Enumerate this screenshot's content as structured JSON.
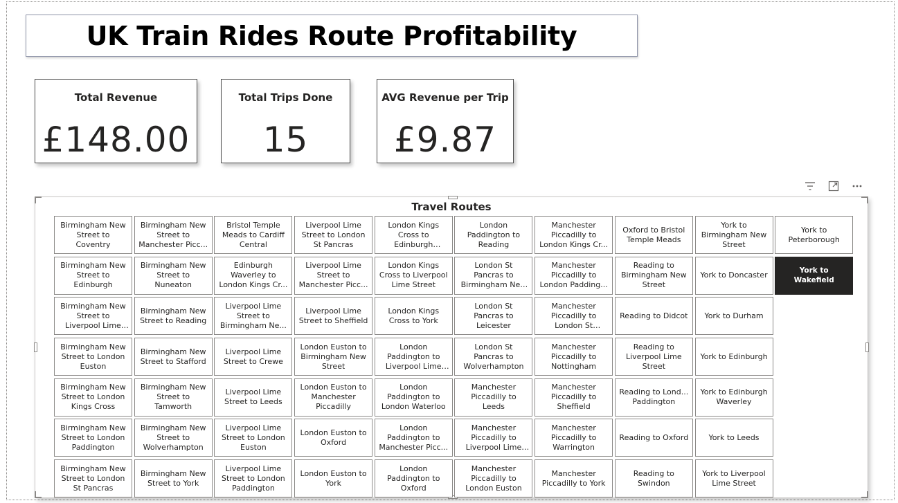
{
  "report": {
    "title": "UK Train Rides Route Profitability"
  },
  "cards": [
    {
      "label": "Total Revenue",
      "value": "£148.00"
    },
    {
      "label": "Total Trips Done",
      "value": "15"
    },
    {
      "label": "AVG Revenue per Trip",
      "value": "£9.87"
    }
  ],
  "toolbar": {
    "filter_icon": "☰",
    "focus_icon": "⤢",
    "more_icon": "⋯"
  },
  "slicer": {
    "title": "Travel Routes",
    "selected": "York to Wakefield",
    "selected_bg": "#252423",
    "columns": [
      [
        "Birmingham New Street to Coventry",
        "Birmingham New Street to Edinburgh",
        "Birmingham New Street to Liverpool Lime Street",
        "Birmingham New Street to London Euston",
        "Birmingham New Street to London Kings Cross",
        "Birmingham New Street to London Paddington",
        "Birmingham New Street to London St Pancras"
      ],
      [
        "Birmingham New Street to Manchester Picc...",
        "Birmingham New Street to Nuneaton",
        "Birmingham New Street to Reading",
        "Birmingham New Street to Stafford",
        "Birmingham New Street to Tamworth",
        "Birmingham New Street to Wolverhampton",
        "Birmingham New Street to York"
      ],
      [
        "Bristol Temple Meads to Cardiff Central",
        "Edinburgh Waverley to London Kings Cr...",
        "Liverpool Lime Street to Birmingham Ne...",
        "Liverpool Lime Street to Crewe",
        "Liverpool Lime Street to Leeds",
        "Liverpool Lime Street to London Euston",
        "Liverpool Lime Street to London Paddington"
      ],
      [
        "Liverpool Lime Street to London St Pancras",
        "Liverpool Lime Street to Manchester Picc...",
        "Liverpool Lime Street to Sheffield",
        "London Euston to Birmingham New Street",
        "London Euston to Manchester Piccadilly",
        "London Euston to Oxford",
        "London Euston to York"
      ],
      [
        "London Kings Cross to Edinburgh Waverley",
        "London Kings Cross to Liverpool Lime Street",
        "London Kings Cross to York",
        "London Paddington to Liverpool Lime S...",
        "London Paddington to London Waterloo",
        "London Paddington to Manchester Picc...",
        "London Paddington to Oxford"
      ],
      [
        "London Paddington to Reading",
        "London St Pancras to Birmingham New Street",
        "London St Pancras to Leicester",
        "London St Pancras to Wolverhampton",
        "Manchester Piccadilly to Leeds",
        "Manchester Piccadilly to Liverpool Lime S...",
        "Manchester Piccadilly to London Euston"
      ],
      [
        "Manchester Piccadilly to London Kings Cr...",
        "Manchester Piccadilly to London Padding...",
        "Manchester Piccadilly to London St Pancras",
        "Manchester Piccadilly to Nottingham",
        "Manchester Piccadilly to Sheffield",
        "Manchester Piccadilly to Warrington",
        "Manchester Piccadilly to York"
      ],
      [
        "Oxford to Bristol Temple Meads",
        "Reading to Birmingham New Street",
        "Reading to Didcot",
        "Reading to Liverpool Lime Street",
        "Reading to Lond... Paddington",
        "Reading to Oxford",
        "Reading to Swindon"
      ],
      [
        "York to Birmingham New Street",
        "York to Doncaster",
        "York to Durham",
        "York to Edinburgh",
        "York to Edinburgh Waverley",
        "York to Leeds",
        "York to Liverpool Lime Street"
      ],
      [
        "York to Peterborough",
        "York to Wakefield"
      ]
    ]
  }
}
